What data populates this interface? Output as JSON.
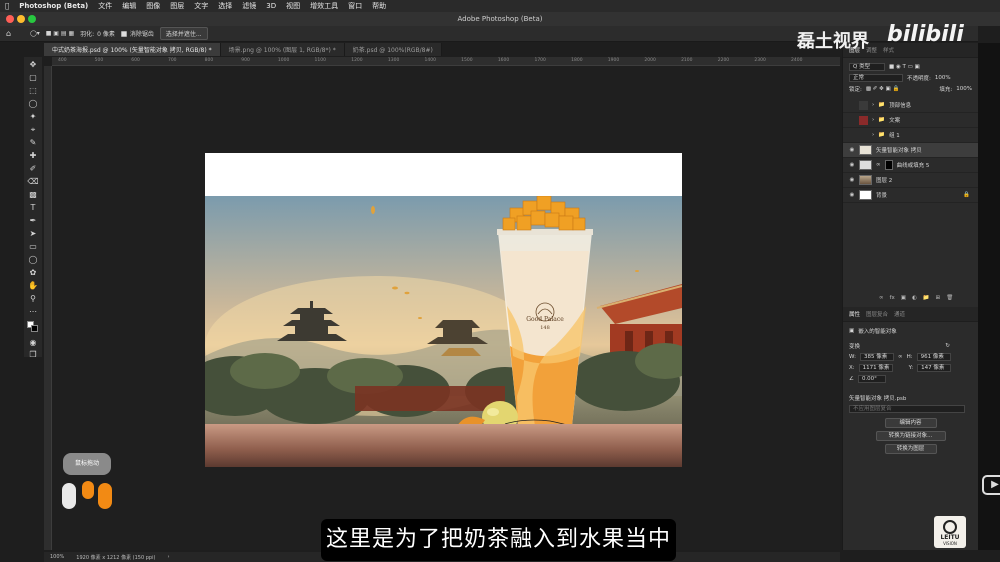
{
  "menubar": {
    "app_name": "Photoshop (Beta)",
    "items": [
      "文件",
      "编辑",
      "图像",
      "图层",
      "文字",
      "选择",
      "滤镜",
      "3D",
      "视图",
      "增效工具",
      "窗口",
      "帮助"
    ]
  },
  "window": {
    "title": "Adobe Photoshop (Beta)"
  },
  "options": {
    "feather_label": "羽化:",
    "feather_value": "0 像素",
    "antialias_label": "消除锯齿",
    "select_mask_button": "选择并遮住..."
  },
  "tabs": [
    {
      "label": "中式奶茶海报.psd @ 100% (矢量智能对象 拷贝, RGB/8) *"
    },
    {
      "label": "场景.png @ 100% (图层 1, RGB/8*) *"
    },
    {
      "label": "奶茶.psd @ 100%(RGB/8#)"
    }
  ],
  "ruler_ticks": [
    "400",
    "500",
    "600",
    "700",
    "800",
    "900",
    "1000",
    "1100",
    "1200",
    "1300",
    "1400",
    "1500",
    "1600",
    "1700",
    "1800",
    "1900",
    "2000",
    "2100",
    "2200",
    "2300",
    "2400"
  ],
  "canvas": {
    "cup_logo_line1": "Good Palace",
    "cup_logo_line2": "148"
  },
  "layers_panel": {
    "tabs": [
      "图层",
      "调整",
      "样式"
    ],
    "filter_label": "Q 类型",
    "blend_mode": "正常",
    "opacity_label": "不透明度:",
    "opacity_value": "100%",
    "lock_label": "锁定:",
    "fill_label": "填充:",
    "fill_value": "100%",
    "layers": [
      {
        "name": "顶部信息",
        "type": "group"
      },
      {
        "name": "文案",
        "type": "group"
      },
      {
        "name": "组 1",
        "type": "group"
      },
      {
        "name": "矢量智能对象 拷贝",
        "type": "smart",
        "selected": true
      },
      {
        "name": "曲线或填充 5",
        "type": "adjust"
      },
      {
        "name": "图层 2",
        "type": "image"
      },
      {
        "name": "背景",
        "type": "background"
      }
    ]
  },
  "properties_panel": {
    "tabs": [
      "属性",
      "图层复合",
      "通道"
    ],
    "object_label": "嵌入的智能对象",
    "transform_label": "变换",
    "w_label": "W:",
    "w_value": "385 像素",
    "h_label": "H:",
    "h_value": "961 像素",
    "x_label": "X:",
    "x_value": "1171 像素",
    "y_label": "Y:",
    "y_value": "147 像素",
    "angle_value": "0.00°",
    "source_label": "矢量智能对象 拷贝.psb",
    "comp_placeholder": "不应用图层复合",
    "btn_edit": "编辑内容",
    "btn_link": "转换为链接对象...",
    "btn_layers": "转换为图层"
  },
  "status": {
    "zoom": "100%",
    "doc_info": "1920 像素 x 1212 像素 (150 ppi)"
  },
  "overlay": {
    "subtitle": "这里是为了把奶茶融入到水果当中",
    "watermark_text": "磊土视界",
    "bili_text": "bilibili",
    "mouse_hint": "鼠标拖动",
    "leitu_line1": "LEITU",
    "leitu_line2": "VISION"
  },
  "colors": {
    "accent": "#2f7de1",
    "selected_layer": "#3d3d3d",
    "cup_orange": "#f2a13a"
  }
}
